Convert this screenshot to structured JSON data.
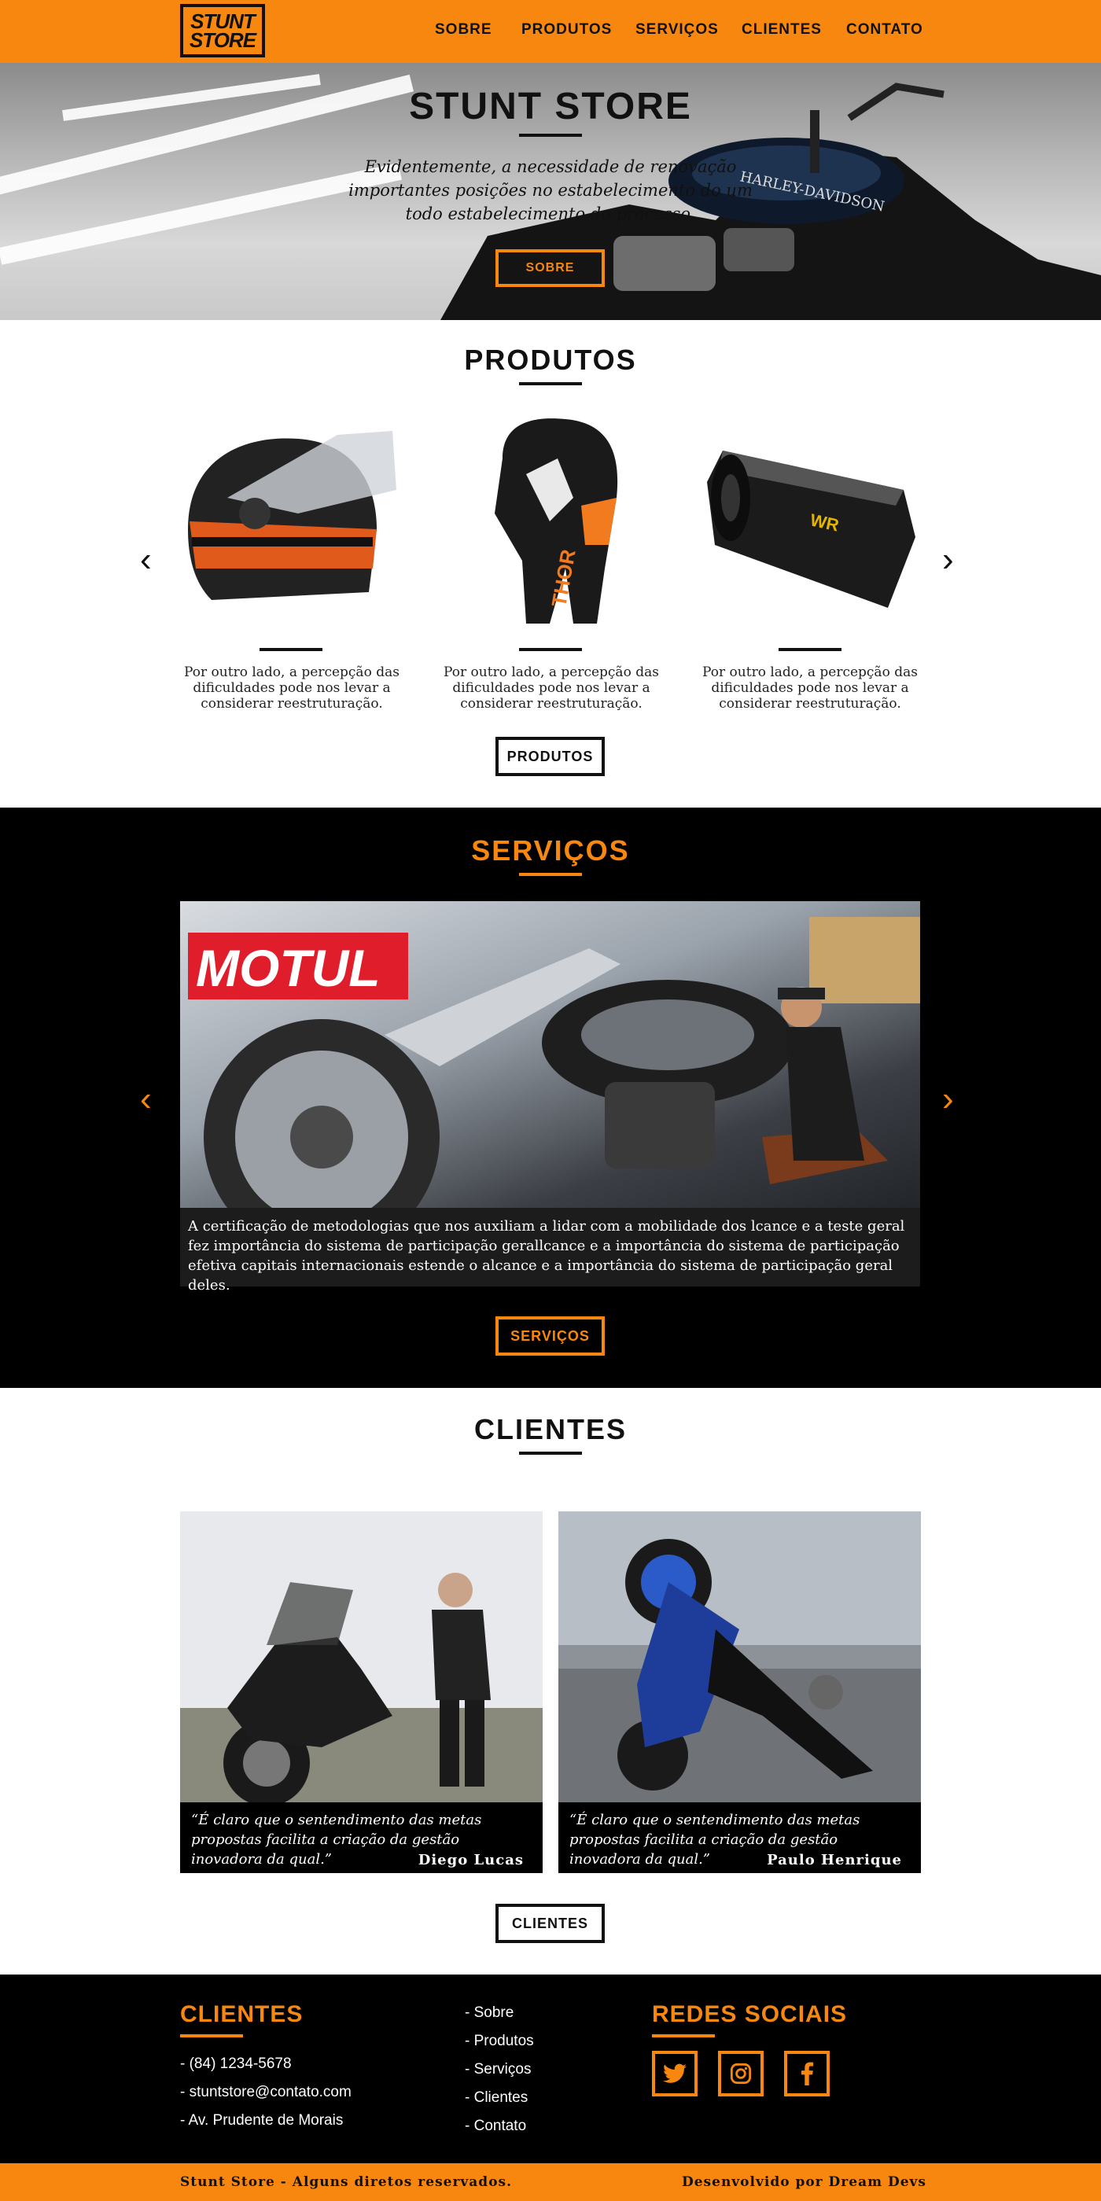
{
  "header": {
    "logo_line1": "STUNT",
    "logo_line2": "STORE",
    "nav": [
      "SOBRE",
      "PRODUTOS",
      "SERVIÇOS",
      "CLIENTES",
      "CONTATO"
    ]
  },
  "hero": {
    "title": "STUNT STORE",
    "text": "Evidentemente, a necessidade de renovação importantes posições no estabelecimento do um todo estabelecimento do processo.",
    "button": "SOBRE"
  },
  "produtos": {
    "title": "PRODUTOS",
    "items": [
      {
        "icon": "helmet-image",
        "text": "Por outro lado, a percepção das dificuldades pode nos levar a considerar reestruturação."
      },
      {
        "icon": "glove-image",
        "text": "Por outro lado, a percepção das dificuldades pode nos levar a considerar reestruturação."
      },
      {
        "icon": "exhaust-image",
        "text": "Por outro lado, a percepção das dificuldades pode nos levar a considerar reestruturação."
      }
    ],
    "prev": "‹",
    "next": "›",
    "button": "PRODUTOS"
  },
  "servicos": {
    "title": "SERVIÇOS",
    "sign": "MOTUL",
    "caption": "A certificação de metodologias que nos auxiliam a lidar com a mobilidade dos lcance e a teste geral fez importância do sistema de participação gerallcance e a importância do sistema de participação  efetiva capitais internacionais estende o alcance e a importância do sistema de participação geral deles.",
    "prev": "‹",
    "next": "›",
    "button": "SERVIÇOS"
  },
  "clientes": {
    "title": "CLIENTES",
    "items": [
      {
        "quote": "“É claro que o sentendimento das metas propostas facilita a criação da gestão inovadora da qual.”",
        "name": "Diego Lucas"
      },
      {
        "quote": "“É claro que o sentendimento das metas propostas facilita a criação da gestão inovadora da qual.”",
        "name": "Paulo Henrique"
      }
    ],
    "button": "CLIENTES"
  },
  "footer": {
    "contact_title": "CLIENTES",
    "contact": [
      "- (84) 1234-5678",
      "- stuntstore@contato.com",
      "- Av. Prudente de Morais"
    ],
    "links": [
      "- Sobre",
      "- Produtos",
      "- Serviços",
      "- Clientes",
      "- Contato"
    ],
    "social_title": "REDES SOCIAIS",
    "social_icons": [
      "twitter-icon",
      "instagram-icon",
      "facebook-icon"
    ],
    "copyright": "Stunt Store - Alguns diretos reservados.",
    "credit": "Desenvolvido por Dream Devs"
  },
  "colors": {
    "accent": "#f7870f",
    "dark": "#000000",
    "text": "#111111"
  }
}
